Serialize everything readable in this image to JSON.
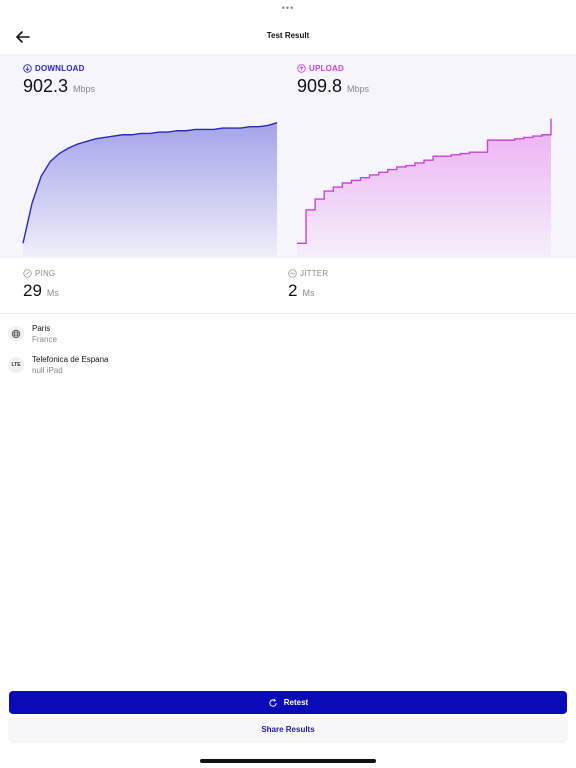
{
  "header": {
    "title": "Test Result",
    "more_glyph": "•••"
  },
  "download": {
    "label": "DOWNLOAD",
    "value": "902.3",
    "unit": "Mbps",
    "color": "#2a2ab8"
  },
  "upload": {
    "label": "UPLOAD",
    "value": "909.8",
    "unit": "Mbps",
    "color": "#c844d8"
  },
  "ping": {
    "label": "PING",
    "value": "29",
    "unit": "Ms"
  },
  "jitter": {
    "label": "JITTER",
    "value": "2",
    "unit": "Ms"
  },
  "location": {
    "city": "Paris",
    "country": "France",
    "icon": "globe-icon"
  },
  "network": {
    "badge": "LTE",
    "carrier": "Telefonica de Espana",
    "device": "null iPad"
  },
  "buttons": {
    "retest": "Retest",
    "share": "Share Results"
  },
  "chart_data": [
    {
      "type": "area",
      "series": [
        {
          "values": [
            0.05,
            0.35,
            0.55,
            0.66,
            0.72,
            0.76,
            0.79,
            0.81,
            0.83,
            0.84,
            0.85,
            0.86,
            0.86,
            0.87,
            0.87,
            0.88,
            0.88,
            0.89,
            0.89,
            0.9,
            0.9,
            0.9,
            0.91,
            0.91,
            0.91,
            0.92,
            0.92,
            0.93,
            0.95
          ]
        }
      ],
      "ylim": [
        0,
        1
      ]
    },
    {
      "type": "area",
      "series": [
        {
          "values": [
            0.05,
            0.3,
            0.38,
            0.44,
            0.47,
            0.5,
            0.52,
            0.54,
            0.56,
            0.58,
            0.6,
            0.62,
            0.63,
            0.65,
            0.67,
            0.7,
            0.7,
            0.71,
            0.72,
            0.73,
            0.73,
            0.82,
            0.82,
            0.82,
            0.83,
            0.84,
            0.85,
            0.86,
            0.98
          ]
        }
      ],
      "ylim": [
        0,
        1
      ]
    }
  ]
}
